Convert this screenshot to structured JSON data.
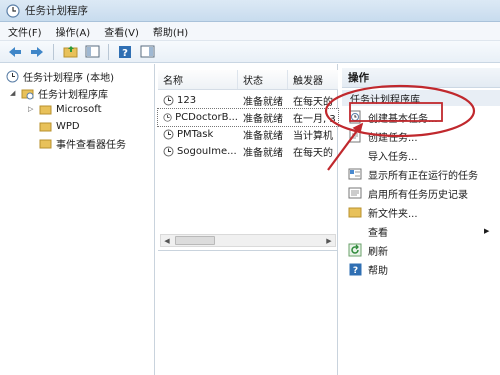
{
  "window": {
    "title": "任务计划程序"
  },
  "menu": [
    "文件(F)",
    "操作(A)",
    "查看(V)",
    "帮助(H)"
  ],
  "toolbar": {
    "icons": [
      "back-arrow-icon",
      "forward-arrow-icon",
      "folder-up-icon",
      "show-pane-icon",
      "help-icon",
      "properties-icon"
    ]
  },
  "tree": {
    "root": "任务计划程序 (本地)",
    "library": "任务计划程序库",
    "children": [
      "Microsoft",
      "WPD",
      "事件查看器任务"
    ]
  },
  "tasks": {
    "columns": [
      "名称",
      "状态",
      "触发器"
    ],
    "rows": [
      {
        "name": "123",
        "status": "准备就绪",
        "trigger": "在每天的"
      },
      {
        "name": "PCDoctorB...",
        "status": "准备就绪",
        "trigger": "在一月, 3"
      },
      {
        "name": "PMTask",
        "status": "准备就绪",
        "trigger": "当计算机"
      },
      {
        "name": "SogouIme...",
        "status": "准备就绪",
        "trigger": "在每天的"
      }
    ]
  },
  "actions": {
    "header": "操作",
    "section": "任务计划程序库",
    "items": [
      {
        "label": "创建基本任务...",
        "icon": "create-basic-task-icon"
      },
      {
        "label": "创建任务...",
        "icon": "create-task-icon"
      },
      {
        "label": "导入任务...",
        "icon": ""
      },
      {
        "label": "显示所有正在运行的任务",
        "icon": "running-tasks-icon"
      },
      {
        "label": "启用所有任务历史记录",
        "icon": "history-icon"
      },
      {
        "label": "新文件夹...",
        "icon": "new-folder-icon"
      },
      {
        "label": "查看",
        "icon": ""
      },
      {
        "label": "刷新",
        "icon": "refresh-icon"
      },
      {
        "label": "帮助",
        "icon": "help-icon"
      }
    ]
  },
  "colors": {
    "annotation": "#c0282d",
    "folder": "#e8c15a",
    "accent_blue": "#2f6fb3"
  }
}
